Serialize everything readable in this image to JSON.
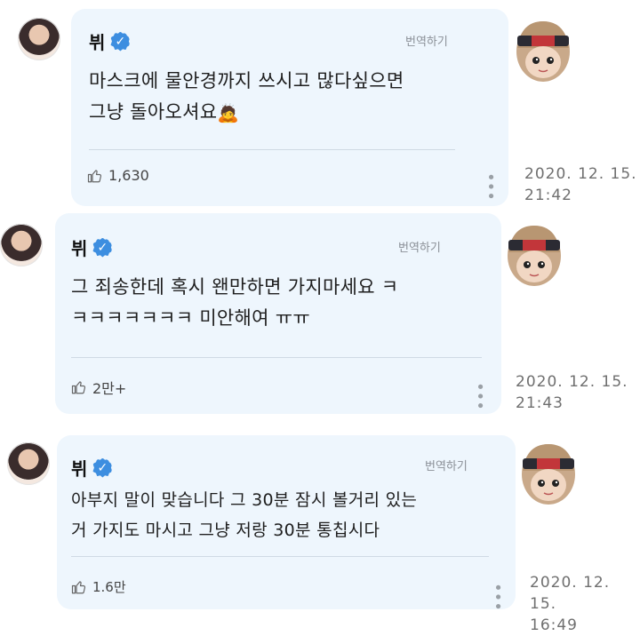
{
  "comments": [
    {
      "name": "뷔",
      "translate_label": "번역하기",
      "text_line1": "마스크에 물안경까지 쓰시고 많다싶으면",
      "text_line2": "그냥 돌아오셔요",
      "emoji": "🙇",
      "likes": "1,630",
      "timestamp_date": "2020. 12. 15.",
      "timestamp_time": "21:42"
    },
    {
      "name": "뷔",
      "translate_label": "번역하기",
      "text_line1": "그 죄송한데 혹시 왠만하면 가지마세요 ㅋ",
      "text_line2": "ㅋㅋㅋㅋㅋㅋㅋ 미안해여 ㅠㅠ",
      "emoji": "",
      "likes": "2만+",
      "timestamp_date": "2020. 12. 15.",
      "timestamp_time": "21:43"
    },
    {
      "name": "뷔",
      "translate_label": "번역하기",
      "text_line1": "아부지 말이 맞습니다 그 30분 잠시 볼거리 있는",
      "text_line2": "거 가지도 마시고 그냥 저랑 30분 통칩시다",
      "emoji": "",
      "likes": "1.6만",
      "timestamp_date": "2020. 12. 15.",
      "timestamp_time": "16:49"
    }
  ],
  "icons": {
    "verified": "verified-badge-icon",
    "like": "thumbs-up-icon",
    "more": "more-vertical-icon",
    "sticker": "character-sticker-icon"
  },
  "colors": {
    "card_bg": "#eef6fd",
    "verified_blue": "#3d8ee0",
    "muted_text": "#8a8f96"
  }
}
